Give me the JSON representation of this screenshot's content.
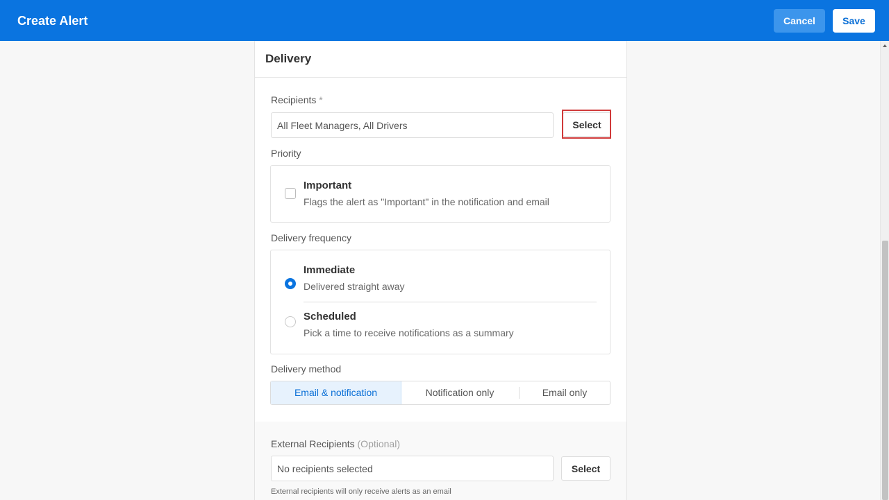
{
  "header": {
    "title": "Create Alert",
    "cancel_label": "Cancel",
    "save_label": "Save"
  },
  "section": {
    "title": "Delivery"
  },
  "recipients": {
    "label": "Recipients",
    "required_mark": "*",
    "value": "All Fleet Managers, All Drivers",
    "select_label": "Select"
  },
  "priority": {
    "label": "Priority",
    "option_title": "Important",
    "option_desc": "Flags the alert as \"Important\" in the notification and email",
    "checked": false
  },
  "frequency": {
    "label": "Delivery frequency",
    "options": [
      {
        "title": "Immediate",
        "desc": "Delivered straight away",
        "selected": true
      },
      {
        "title": "Scheduled",
        "desc": "Pick a time to receive notifications as a summary",
        "selected": false
      }
    ]
  },
  "method": {
    "label": "Delivery method",
    "options": [
      "Email & notification",
      "Notification only",
      "Email only"
    ],
    "selected": "Email & notification"
  },
  "external": {
    "label": "External Recipients",
    "optional_mark": "(Optional)",
    "placeholder": "No recipients selected",
    "select_label": "Select",
    "note": "External recipients will only receive alerts as an email"
  },
  "colors": {
    "primary": "#0a74e0",
    "highlight": "#d03a3a"
  }
}
